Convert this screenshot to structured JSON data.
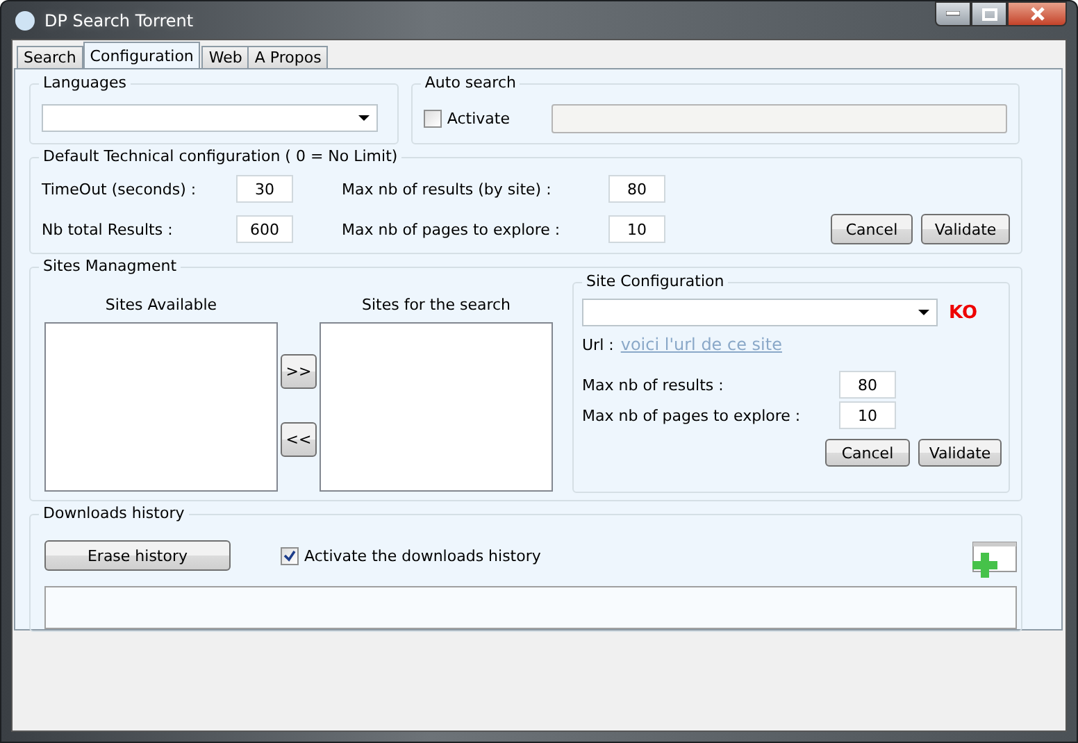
{
  "window": {
    "title": "DP Search Torrent"
  },
  "tabs": [
    {
      "label": "Search",
      "selected": false
    },
    {
      "label": "Configuration",
      "selected": true
    },
    {
      "label": "Web",
      "selected": false
    },
    {
      "label": "A Propos",
      "selected": false
    }
  ],
  "languages": {
    "legend": "Languages"
  },
  "auto_search": {
    "legend": "Auto search",
    "checkbox": {
      "label": "Activate",
      "checked": false
    },
    "field": {
      "disabled": true
    }
  },
  "default_config": {
    "legend": "Default Technical configuration ( 0 = No Limit)",
    "fields": [
      {
        "label": "TimeOut (seconds) :",
        "value": "30"
      },
      {
        "label": "Max nb of results (by site) :",
        "value": "80"
      },
      {
        "label": "Nb total Results :",
        "value": "600"
      },
      {
        "label": "Max nb of pages to explore :",
        "value": "10"
      }
    ],
    "buttons": [
      "Cancel",
      "Validate"
    ]
  },
  "sites": {
    "legend": "Sites Managment",
    "available_label": "Sites Available",
    "search_label": "Sites for the search",
    "move_buttons": [
      ">>",
      "<<"
    ],
    "site_config": {
      "legend": "Site Configuration",
      "status": "KO",
      "url_label": "Url :",
      "url_link": "voici l'url de ce site",
      "fields": [
        {
          "label": "Max nb of results :",
          "value": "80"
        },
        {
          "label": "Max nb of pages to explore :",
          "value": "10"
        }
      ],
      "buttons": [
        "Cancel",
        "Validate"
      ]
    }
  },
  "downloads": {
    "legend": "Downloads history",
    "erase_button": "Erase history",
    "checkbox": {
      "label": "Activate the downloads history",
      "checked": true
    }
  }
}
